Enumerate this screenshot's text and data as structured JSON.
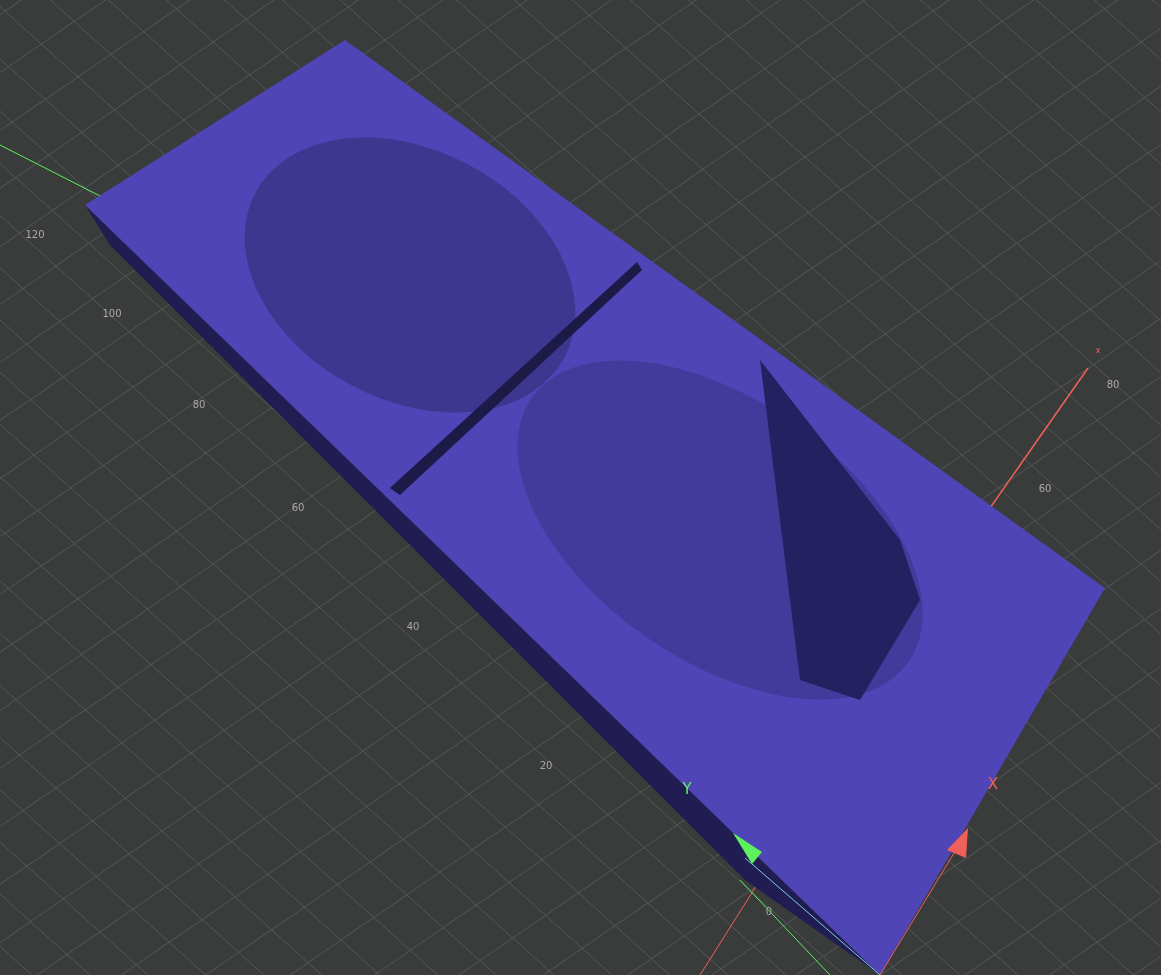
{
  "viewport": {
    "grid_labels": [
      "120",
      "100",
      "80",
      "60",
      "40",
      "20",
      "0",
      "80",
      "60"
    ],
    "axes": [
      {
        "label": "Y",
        "color": "#5ef05e"
      },
      {
        "label": "X",
        "color": "#f0605a"
      }
    ],
    "axis_end_label": "x"
  }
}
